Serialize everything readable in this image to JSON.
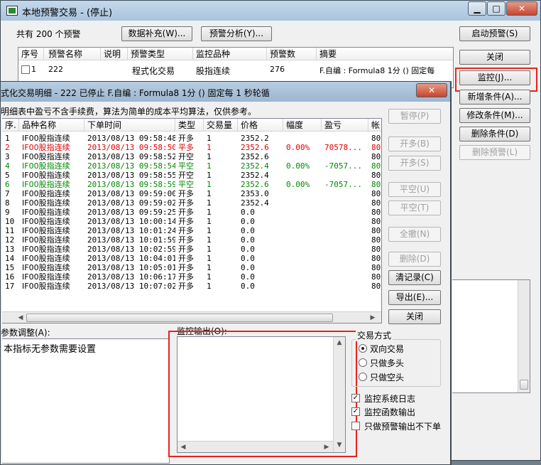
{
  "main_window": {
    "title": "本地预警交易 - (停止)",
    "count_label": "共有 200 个预警",
    "buttons": {
      "data_supplement": "数据补充(W)...",
      "alert_analysis": "预警分析(Y)...",
      "start_alert": "启动预警(S)",
      "close": "关闭",
      "monitor": "监控(J)...",
      "add_condition": "新增条件(A)...",
      "modify_condition": "修改条件(M)...",
      "delete_condition": "删除条件(D)",
      "delete_alert": "删除预警(L)"
    },
    "table": {
      "columns": [
        "序号",
        "预警名称",
        "说明",
        "预警类型",
        "监控品种",
        "预警数",
        "摘要"
      ],
      "rows": [
        {
          "no": "1",
          "name": "222",
          "desc": "",
          "type": "程式化交易",
          "variety": "股指连续",
          "count": "276",
          "summary": "F.自编 : Formula8 1分 () 固定每"
        }
      ]
    }
  },
  "detail_window": {
    "title": "式化交易明细 - 222 已停止  F.自编 : Formula8 1分 () 固定每 1 秒轮循",
    "note": "明细表中盈亏不含手续费，算法为简单的成本平均算法，仅供参考。",
    "columns": [
      "序.",
      "品种名称",
      "下单时间",
      "类型",
      "交易量",
      "价格",
      "幅度",
      "盈亏",
      "帐"
    ],
    "rows": [
      {
        "no": "1",
        "name": "IF00股指连续",
        "time": "2013/08/13 09:58:48",
        "type": "开多",
        "qty": "1",
        "price": "2352.2",
        "range": "",
        "pnl": "",
        "acct": "80",
        "color": "black"
      },
      {
        "no": "2",
        "name": "IF00股指连续",
        "time": "2013/08/13 09:58:50",
        "type": "平多",
        "qty": "1",
        "price": "2352.6",
        "range": "0.00%",
        "pnl": "70578...",
        "acct": "80",
        "color": "red"
      },
      {
        "no": "3",
        "name": "IF00股指连续",
        "time": "2013/08/13 09:58:52",
        "type": "开空",
        "qty": "1",
        "price": "2352.6",
        "range": "",
        "pnl": "",
        "acct": "80",
        "color": "black"
      },
      {
        "no": "4",
        "name": "IF00股指连续",
        "time": "2013/08/13 09:58:54",
        "type": "平空",
        "qty": "1",
        "price": "2352.4",
        "range": "0.00%",
        "pnl": "-7057...",
        "acct": "80",
        "color": "green"
      },
      {
        "no": "5",
        "name": "IF00股指连续",
        "time": "2013/08/13 09:58:55",
        "type": "开空",
        "qty": "1",
        "price": "2352.4",
        "range": "",
        "pnl": "",
        "acct": "80",
        "color": "black"
      },
      {
        "no": "6",
        "name": "IF00股指连续",
        "time": "2013/08/13 09:58:59",
        "type": "平空",
        "qty": "1",
        "price": "2352.6",
        "range": "0.00%",
        "pnl": "-7057...",
        "acct": "80",
        "color": "green"
      },
      {
        "no": "7",
        "name": "IF00股指连续",
        "time": "2013/08/13 09:59:00",
        "type": "开多",
        "qty": "1",
        "price": "2353.0",
        "range": "",
        "pnl": "",
        "acct": "80",
        "color": "black"
      },
      {
        "no": "8",
        "name": "IF00股指连续",
        "time": "2013/08/13 09:59:02",
        "type": "开多",
        "qty": "1",
        "price": "2352.4",
        "range": "",
        "pnl": "",
        "acct": "80",
        "color": "black"
      },
      {
        "no": "9",
        "name": "IF00股指连续",
        "time": "2013/08/13 09:59:25",
        "type": "开多",
        "qty": "1",
        "price": "0.0",
        "range": "",
        "pnl": "",
        "acct": "80",
        "color": "black"
      },
      {
        "no": "10",
        "name": "IF00股指连续",
        "time": "2013/08/13 10:00:14",
        "type": "开多",
        "qty": "1",
        "price": "0.0",
        "range": "",
        "pnl": "",
        "acct": "80",
        "color": "black"
      },
      {
        "no": "11",
        "name": "IF00股指连续",
        "time": "2013/08/13 10:01:24",
        "type": "开多",
        "qty": "1",
        "price": "0.0",
        "range": "",
        "pnl": "",
        "acct": "80",
        "color": "black"
      },
      {
        "no": "12",
        "name": "IF00股指连续",
        "time": "2013/08/13 10:01:59",
        "type": "开多",
        "qty": "1",
        "price": "0.0",
        "range": "",
        "pnl": "",
        "acct": "80",
        "color": "black"
      },
      {
        "no": "13",
        "name": "IF00股指连续",
        "time": "2013/08/13 10:02:59",
        "type": "开多",
        "qty": "1",
        "price": "0.0",
        "range": "",
        "pnl": "",
        "acct": "80",
        "color": "black"
      },
      {
        "no": "14",
        "name": "IF00股指连续",
        "time": "2013/08/13 10:04:01",
        "type": "开多",
        "qty": "1",
        "price": "0.0",
        "range": "",
        "pnl": "",
        "acct": "80",
        "color": "black"
      },
      {
        "no": "15",
        "name": "IF00股指连续",
        "time": "2013/08/13 10:05:01",
        "type": "开多",
        "qty": "1",
        "price": "0.0",
        "range": "",
        "pnl": "",
        "acct": "80",
        "color": "black"
      },
      {
        "no": "16",
        "name": "IF00股指连续",
        "time": "2013/08/13 10:06:17",
        "type": "开多",
        "qty": "1",
        "price": "0.0",
        "range": "",
        "pnl": "",
        "acct": "80",
        "color": "black"
      },
      {
        "no": "17",
        "name": "IF00股指连续",
        "time": "2013/08/13 10:07:02",
        "type": "开多",
        "qty": "1",
        "price": "0.0",
        "range": "",
        "pnl": "",
        "acct": "80",
        "color": "black"
      }
    ],
    "buttons": {
      "pause": "暂停(P)",
      "open_long": "开多(B)",
      "open_short": "开多(S)",
      "close_short": "平空(U)",
      "close_long": "平空(T)",
      "close_all": "全撤(N)",
      "delete": "删除(D)",
      "clear_records": "清记录(C)",
      "export": "导出(E)...",
      "close": "关闭"
    },
    "param_label": "参数调整(A):",
    "param_text": "本指标无参数需要设置",
    "monitor_output_label": "监控输出(O):",
    "trade_mode": {
      "label": "交易方式",
      "options": [
        "双向交易",
        "只做多头",
        "只做空头"
      ],
      "selected": 0
    },
    "checkboxes": [
      {
        "label": "监控系统日志",
        "checked": true
      },
      {
        "label": "监控函数输出",
        "checked": true
      },
      {
        "label": "只做预警输出不下单",
        "checked": false
      }
    ]
  },
  "colors": {
    "red": "#e00000",
    "green": "#008800",
    "highlight_box": "#e8231d"
  }
}
